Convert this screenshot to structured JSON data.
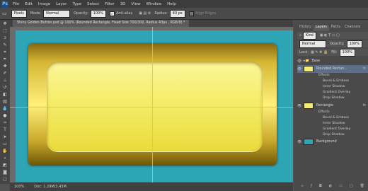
{
  "menubar": {
    "logo": "Ps",
    "items": [
      "File",
      "Edit",
      "Image",
      "Layer",
      "Type",
      "Select",
      "Filter",
      "3D",
      "View",
      "Window",
      "Help"
    ]
  },
  "options": {
    "mode_select": "Pixels",
    "mode_label": "Mode:",
    "mode_value": "Normal",
    "opacity_label": "Opacity:",
    "opacity_value": "100%",
    "antialias_label": "Anti-alias",
    "radius_label": "Radius:",
    "radius_value": "40 px",
    "align_edges_label": "Align Edges"
  },
  "document": {
    "tab_title": "Shiny Golden Button.psd @ 100% (Rounded Rectangle, Fixed Size 700/300, Radius 40px , RGB/8) *",
    "zoom": "100%",
    "doc_info": "Doc: 1.29M/3.43M"
  },
  "panels": {
    "tabs": [
      "History",
      "Layers",
      "Paths",
      "Channels"
    ],
    "kind_label": "Kind",
    "blend_mode": "Normal",
    "opacity_label": "Opacity:",
    "opacity_value": "100%",
    "lock_label": "Lock:",
    "fill_label": "Fill:",
    "fill_value": "100%",
    "fx_symbol": "fx",
    "layers": {
      "group": "Base",
      "rounded": "Rounded Rectan...",
      "rectangle": "Rectangle",
      "background": "Background",
      "effects_label": "Effects",
      "effects": [
        "Bevel & Emboss",
        "Inner Shadow",
        "Gradient Overlay",
        "Drop Shadow"
      ]
    }
  },
  "colors": {
    "canvas_bg": "#2da5b5",
    "button_gold": "#f6ee6e",
    "guide": "#5fe0ff"
  }
}
